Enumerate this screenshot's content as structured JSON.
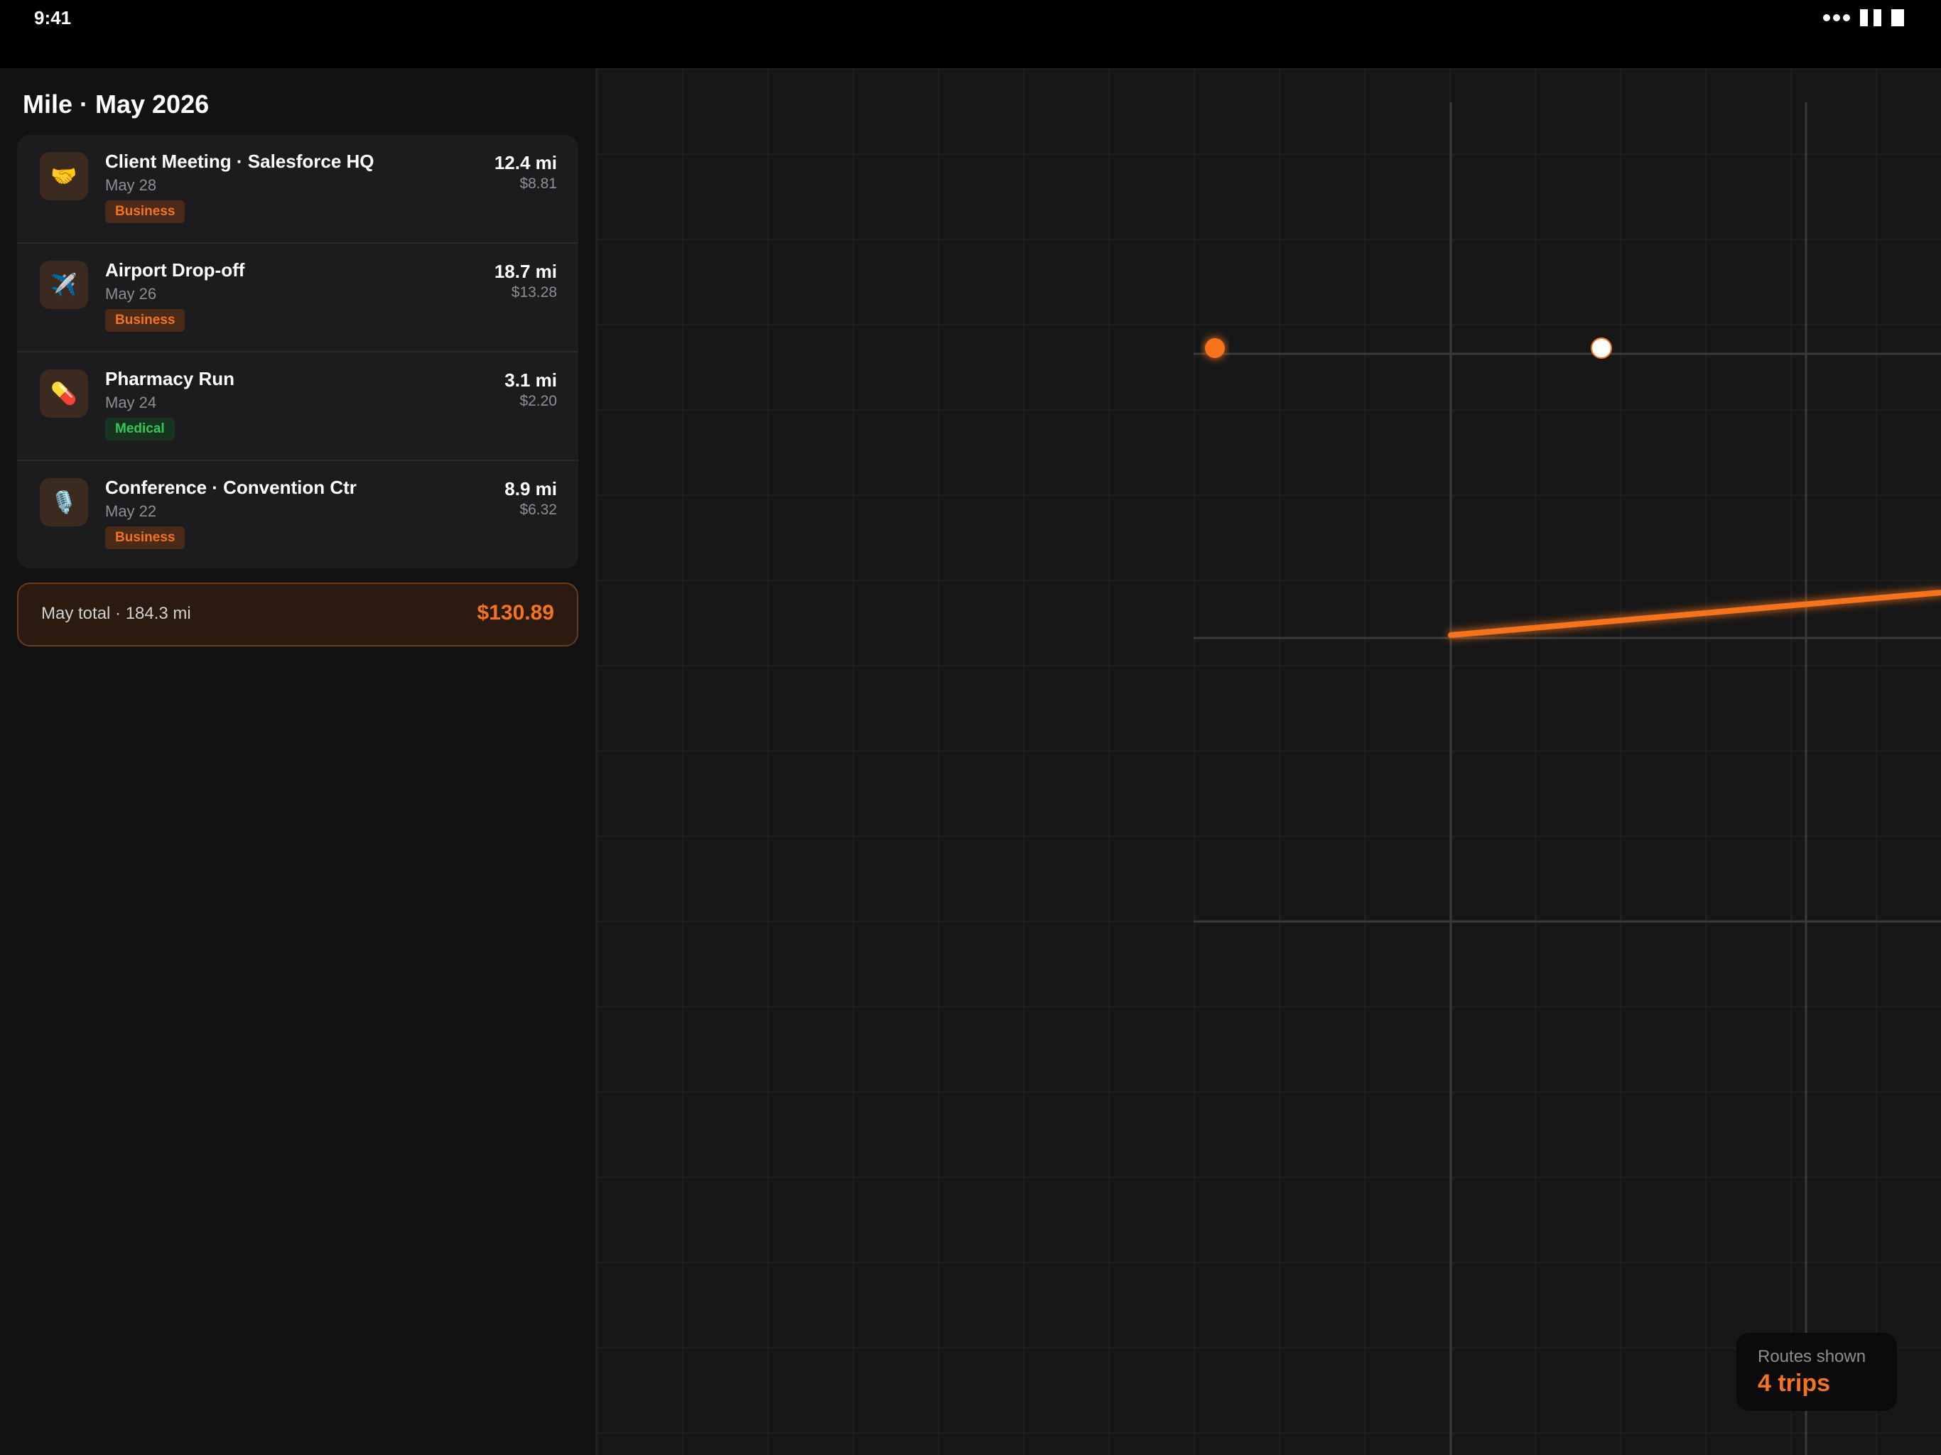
{
  "status_bar": {
    "time": "9:41"
  },
  "sidebar": {
    "title": "Mile · May 2026",
    "trips": [
      {
        "icon": "🤝",
        "icon_name": "handshake-icon",
        "name": "Client Meeting · Salesforce HQ",
        "date": "May 28",
        "category": "Business",
        "miles": "12.4 mi",
        "amount": "$8.81"
      },
      {
        "icon": "✈️",
        "icon_name": "airplane-icon",
        "name": "Airport Drop-off",
        "date": "May 26",
        "category": "Business",
        "miles": "18.7 mi",
        "amount": "$13.28"
      },
      {
        "icon": "💊",
        "icon_name": "pill-icon",
        "name": "Pharmacy Run",
        "date": "May 24",
        "category": "Medical",
        "miles": "3.1 mi",
        "amount": "$2.20"
      },
      {
        "icon": "🎙️",
        "icon_name": "microphone-icon",
        "name": "Conference · Convention Ctr",
        "date": "May 22",
        "category": "Business",
        "miles": "8.9 mi",
        "amount": "$6.32"
      }
    ],
    "total": {
      "label": "May total · 184.3 mi",
      "value": "$130.89"
    }
  },
  "map": {
    "routes_card": {
      "label": "Routes shown",
      "value": "4 trips"
    }
  },
  "colors": {
    "accent": "#f5731f",
    "business_badge_bg": "#4a2a18",
    "medical_badge_bg": "#16331f",
    "medical_text": "#34c759",
    "background": "#121212"
  }
}
